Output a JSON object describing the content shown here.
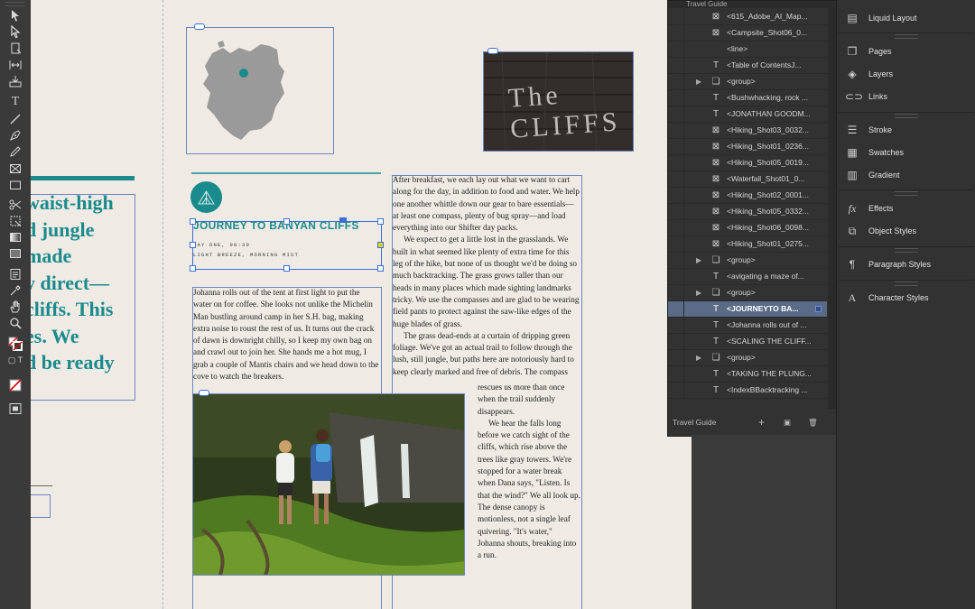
{
  "canvas": {
    "big_lines": [
      "waist-high",
      "d jungle",
      "made",
      "y direct—",
      "cliffs. This",
      "es. We",
      "d be ready"
    ],
    "title": "JOURNEY TO BANYAN CLIFFS",
    "dateline": "DAY ONE, 08:30",
    "conditions": "LIGHT BREEZE, MORNING MIST",
    "image_text": "The CLIFFS",
    "left_column": "Johanna rolls out of the tent at first light to put the water on for coffee. She looks not unlike the Michelin Man bustling around camp in her S.H. bag, making extra noise to roust the rest of us. It turns out the crack of dawn is downright chilly, so I keep my own bag on and crawl out to join her. She hands me a hot mug, I grab a couple of Mantis chairs and we head down to the cove to watch the breakers.",
    "right_column": [
      "After breakfast, we each lay out what we want to cart along for the day, in addition to food and water. We help one another whittle down our gear to bare essentials—at least one compass, plenty of bug spray—and load everything into our Shifter day packs.",
      "We expect to get a little lost in the grasslands. We built in what seemed like plenty of extra time for this leg of the hike, but none of us thought we'd be doing so much backtracking. The grass grows taller than our heads in many places which made sighting landmarks tricky. We use the compasses and are glad to be wearing field pants to protect against the saw-like edges of the huge blades of grass.",
      "The grass dead-ends at a curtain of dripping green foliage. We've got an actual trail to follow through the lush, still jungle, but paths here are notoriously hard to keep clearly marked and free of debris. The compass"
    ],
    "narrow_column": [
      "rescues us more than once when the trail suddenly disappears.",
      "We hear the falls long before we catch sight of the cliffs, which rise above the trees like gray towers. We're stopped for a water break when Dana says, \"Listen. Is that the wind?\" We all look up. The dense canopy is motionless, not a single leaf quivering. \"It's water,\" Johanna shouts, breaking into a run."
    ]
  },
  "layers_panel": {
    "header": "Travel Guide",
    "footer_label": "Travel Guide",
    "rows": [
      {
        "icon": "image",
        "label": "<615_Adobe_AI_Map...",
        "tri": false,
        "selected": false
      },
      {
        "icon": "image",
        "label": "<Campsite_Shot06_0...",
        "tri": false,
        "selected": false
      },
      {
        "icon": "none",
        "label": "<line>",
        "tri": false,
        "selected": false
      },
      {
        "icon": "text",
        "label": "<Table of ContentsJ...",
        "tri": false,
        "selected": false
      },
      {
        "icon": "group",
        "label": "<group>",
        "tri": true,
        "selected": false
      },
      {
        "icon": "text",
        "label": "<Bushwhacking, rock ...",
        "tri": false,
        "selected": false
      },
      {
        "icon": "text",
        "label": "<JONATHAN GOODM...",
        "tri": false,
        "selected": false
      },
      {
        "icon": "image",
        "label": "<Hiking_Shot03_0032...",
        "tri": false,
        "selected": false
      },
      {
        "icon": "image",
        "label": "<Hiking_Shot01_0236...",
        "tri": false,
        "selected": false
      },
      {
        "icon": "image",
        "label": "<Hiking_Shot05_0019...",
        "tri": false,
        "selected": false
      },
      {
        "icon": "image",
        "label": "<Waterfall_Shot01_0...",
        "tri": false,
        "selected": false
      },
      {
        "icon": "image",
        "label": "<Hiking_Shot02_0001...",
        "tri": false,
        "selected": false
      },
      {
        "icon": "image",
        "label": "<Hiking_Shot05_0332...",
        "tri": false,
        "selected": false
      },
      {
        "icon": "image",
        "label": "<Hiking_Shot06_0098...",
        "tri": false,
        "selected": false
      },
      {
        "icon": "image",
        "label": "<Hiking_Shot01_0275...",
        "tri": false,
        "selected": false
      },
      {
        "icon": "group",
        "label": "<group>",
        "tri": true,
        "selected": false
      },
      {
        "icon": "text",
        "label": "<avigating a maze of...",
        "tri": false,
        "selected": false
      },
      {
        "icon": "group",
        "label": "<group>",
        "tri": true,
        "selected": false
      },
      {
        "icon": "text",
        "label": "<JOURNEYTO BA...",
        "tri": false,
        "selected": true
      },
      {
        "icon": "text",
        "label": "<Johanna rolls out of ...",
        "tri": false,
        "selected": false
      },
      {
        "icon": "text",
        "label": "<SCALING THE CLIFF...",
        "tri": false,
        "selected": false
      },
      {
        "icon": "group",
        "label": "<group>",
        "tri": true,
        "selected": false
      },
      {
        "icon": "text",
        "label": "<TAKING THE PLUNG...",
        "tri": false,
        "selected": false
      },
      {
        "icon": "text",
        "label": "<IndexBBacktracking ...",
        "tri": false,
        "selected": false
      }
    ]
  },
  "right_panels": {
    "items": [
      {
        "name": "liquid-layout",
        "label": "Liquid Layout",
        "icon": "liquid-layout-icon"
      },
      {
        "name": "pages",
        "label": "Pages",
        "icon": "pages-icon"
      },
      {
        "name": "layers",
        "label": "Layers",
        "icon": "layers-icon"
      },
      {
        "name": "links",
        "label": "Links",
        "icon": "links-icon"
      },
      {
        "name": "stroke",
        "label": "Stroke",
        "icon": "stroke-icon"
      },
      {
        "name": "swatches",
        "label": "Swatches",
        "icon": "swatches-icon"
      },
      {
        "name": "gradient",
        "label": "Gradient",
        "icon": "gradient-icon"
      },
      {
        "name": "effects",
        "label": "Effects",
        "icon": "effects-icon"
      },
      {
        "name": "object-styles",
        "label": "Object Styles",
        "icon": "object-styles-icon"
      },
      {
        "name": "paragraph-styles",
        "label": "Paragraph Styles",
        "icon": "paragraph-styles-icon"
      },
      {
        "name": "character-styles",
        "label": "Character Styles",
        "icon": "character-styles-icon"
      }
    ]
  },
  "colors": {
    "accent_teal": "#1a8a8c",
    "selection_blue": "#3a6fd8",
    "layer_selected": "#596b86"
  }
}
